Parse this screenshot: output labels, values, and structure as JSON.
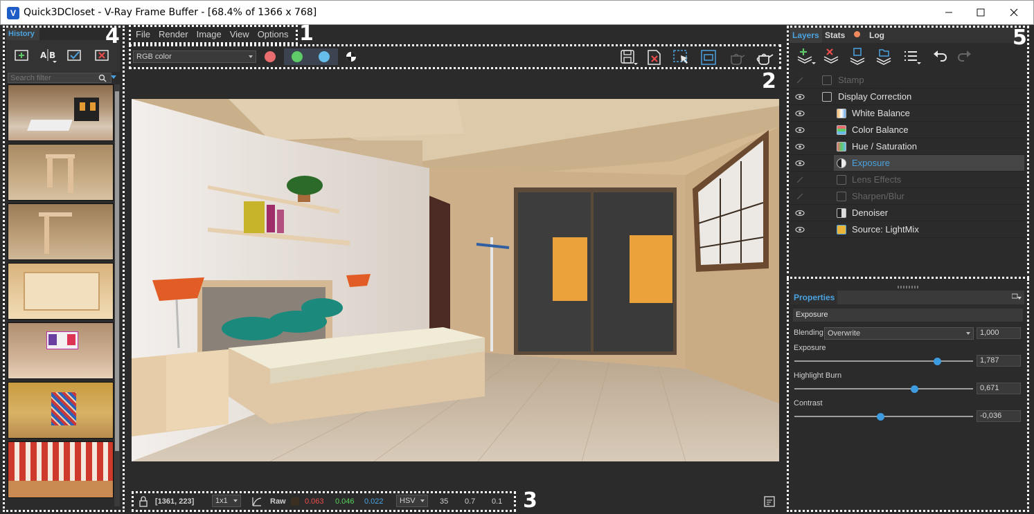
{
  "window": {
    "title": "Quick3DCloset - V-Ray Frame Buffer - [68.4% of 1366 x 768]",
    "app_icon": "V"
  },
  "region_labels": [
    "1",
    "2",
    "3",
    "4",
    "5"
  ],
  "menu": [
    "File",
    "Render",
    "Image",
    "View",
    "Options"
  ],
  "toolbar": {
    "channel_select": "RGB color",
    "channel_colors": {
      "red": "#e96d6f",
      "green": "#5ecb68",
      "blue": "#66bde9"
    }
  },
  "history": {
    "tab": "History",
    "search_placeholder": "Search filter",
    "thumbnails": [
      "bedroom-render",
      "frame-render",
      "shelf-render",
      "room-render",
      "wardrobe-render",
      "pattern-render",
      "stripes-render"
    ]
  },
  "status": {
    "coords": "[1361, 223]",
    "zoom": "1x1",
    "mode": "Raw",
    "r": "0.063",
    "g": "0.046",
    "b": "0.022",
    "colorspace": "HSV",
    "h": "35",
    "s": "0.7",
    "v": "0.1",
    "colors": {
      "r": "#ee4b4b",
      "g": "#56d35c",
      "b": "#4aa3e0"
    }
  },
  "right_tabs": {
    "layers": "Layers",
    "stats": "Stats",
    "log": "Log"
  },
  "layers": [
    {
      "name": "Stamp",
      "enabled": false,
      "indent": 0
    },
    {
      "name": "Display Correction",
      "enabled": true,
      "indent": 0
    },
    {
      "name": "White Balance",
      "enabled": true,
      "indent": 1
    },
    {
      "name": "Color Balance",
      "enabled": true,
      "indent": 1
    },
    {
      "name": "Hue / Saturation",
      "enabled": true,
      "indent": 1
    },
    {
      "name": "Exposure",
      "enabled": true,
      "indent": 1,
      "selected": true
    },
    {
      "name": "Lens Effects",
      "enabled": false,
      "indent": 1
    },
    {
      "name": "Sharpen/Blur",
      "enabled": false,
      "indent": 1
    },
    {
      "name": "Denoiser",
      "enabled": true,
      "indent": 1
    },
    {
      "name": "Source: LightMix",
      "enabled": true,
      "indent": 1
    }
  ],
  "properties": {
    "tab": "Properties",
    "section": "Exposure",
    "blending_label": "Blending",
    "blending_mode": "Overwrite",
    "blending_value": "1,000",
    "params": [
      {
        "label": "Exposure",
        "value": "1,787",
        "level": 0.8
      },
      {
        "label": "Highlight Burn",
        "value": "0,671",
        "level": 0.67
      },
      {
        "label": "Contrast",
        "value": "-0,036",
        "level": 0.48
      }
    ]
  },
  "colors": {
    "accent": "#4aa3e0",
    "selected_row": "#454545",
    "panel": "#2b2b2b"
  }
}
